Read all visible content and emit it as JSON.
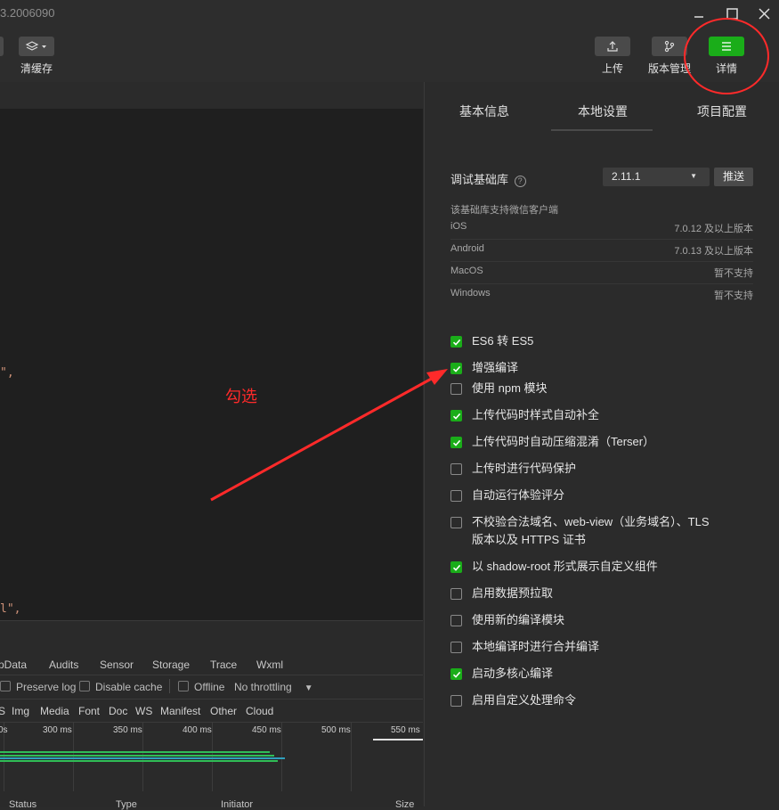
{
  "titlebar": {
    "title": "3.2006090"
  },
  "toolbar": {
    "clear_cache_label": "清缓存",
    "upload_label": "上传",
    "version_label": "版本管理",
    "detail_label": "详情"
  },
  "editor": {
    "line1_suffix": "\",",
    "line2_prefix": "l\","
  },
  "devtools": {
    "tabs": [
      "pData",
      "Audits",
      "Sensor",
      "Storage",
      "Trace",
      "Wxml"
    ],
    "preserve_log": "Preserve log",
    "disable_cache": "Disable cache",
    "offline": "Offline",
    "throttling": "No throttling",
    "filters": [
      "S",
      "Img",
      "Media",
      "Font",
      "Doc",
      "WS",
      "Manifest",
      "Other",
      "Cloud"
    ],
    "ticks": [
      "0s",
      "300 ms",
      "350 ms",
      "400 ms",
      "450 ms",
      "500 ms",
      "550 ms"
    ],
    "columns": [
      "Status",
      "Type",
      "Initiator",
      "Size"
    ]
  },
  "panel": {
    "tabs": [
      "基本信息",
      "本地设置",
      "项目配置"
    ],
    "active_tab": "本地设置",
    "debug_lib_label": "调试基础库",
    "debug_lib_version": "2.11.1",
    "push_button": "推送",
    "support_title": "该基础库支持微信客户端",
    "platforms": [
      {
        "name": "iOS",
        "value": "7.0.12 及以上版本"
      },
      {
        "name": "Android",
        "value": "7.0.13 及以上版本"
      },
      {
        "name": "MacOS",
        "value": "暂不支持"
      },
      {
        "name": "Windows",
        "value": "暂不支持"
      }
    ],
    "options": [
      {
        "label": "ES6 转 ES5",
        "checked": true
      },
      {
        "label": "增强编译",
        "checked": true
      },
      {
        "label": "使用 npm 模块",
        "checked": false
      },
      {
        "label": "上传代码时样式自动补全",
        "checked": true
      },
      {
        "label": "上传代码时自动压缩混淆（Terser）",
        "checked": true
      },
      {
        "label": "上传时进行代码保护",
        "checked": false
      },
      {
        "label": "自动运行体验评分",
        "checked": false
      },
      {
        "label": "不校验合法域名、web-view（业务域名）、TLS",
        "label2": "版本以及 HTTPS 证书",
        "checked": false
      },
      {
        "label": "以 shadow-root 形式展示自定义组件",
        "checked": true
      },
      {
        "label": "启用数据预拉取",
        "checked": false
      },
      {
        "label": "使用新的编译模块",
        "checked": false
      },
      {
        "label": "本地编译时进行合并编译",
        "checked": false
      },
      {
        "label": "启动多核心编译",
        "checked": true
      },
      {
        "label": "启用自定义处理命令",
        "checked": false
      }
    ]
  },
  "annotation": {
    "text": "勾选",
    "color": "#ff2a2a"
  },
  "colors": {
    "accent": "#1aad19",
    "annotation": "#ff2a2a"
  }
}
